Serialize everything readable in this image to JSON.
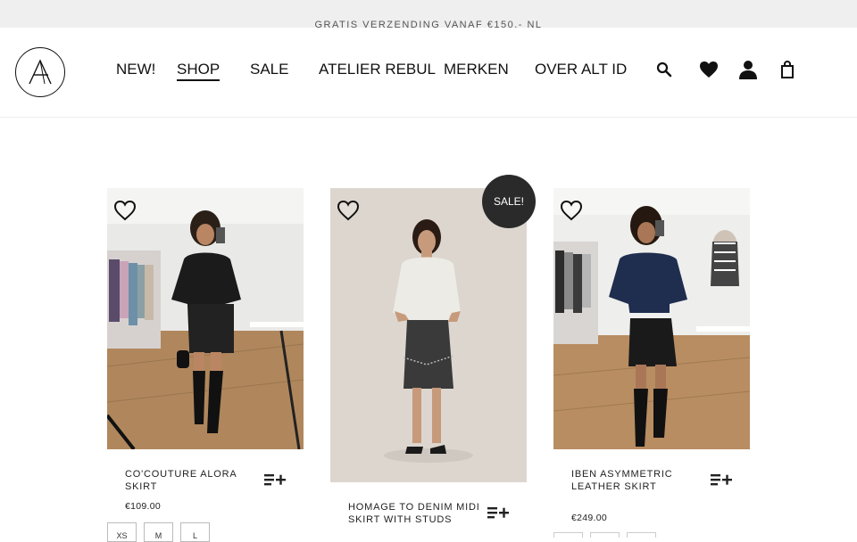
{
  "announcement": "GRATIS VERZENDING VANAF €150,- NL",
  "brand": {
    "logo_letter": "A"
  },
  "nav": [
    {
      "label": "NEW!",
      "active": false
    },
    {
      "label": "SHOP",
      "active": true
    },
    {
      "label": "SALE",
      "active": false
    },
    {
      "label": "ATELIER REBUL",
      "active": false
    },
    {
      "label": "MERKEN",
      "active": false
    },
    {
      "label": "OVER ALT ID",
      "active": false
    }
  ],
  "header_icons": [
    "search-icon",
    "heart-icon",
    "user-icon",
    "bag-icon"
  ],
  "products": [
    {
      "name": "CO'COUTURE ALORA SKIRT",
      "price": "€109.00",
      "sizes": [
        "XS",
        "M",
        "L"
      ],
      "sale": false
    },
    {
      "name": "HOMAGE TO DENIM MIDI SKIRT WITH STUDS",
      "price": "",
      "sizes": [],
      "sale": true,
      "badge": "SALE!"
    },
    {
      "name": "IBEN ASYMMETRIC LEATHER SKIRT",
      "price": "€249.00",
      "sizes": [
        "",
        "",
        ""
      ],
      "sale": false
    }
  ]
}
